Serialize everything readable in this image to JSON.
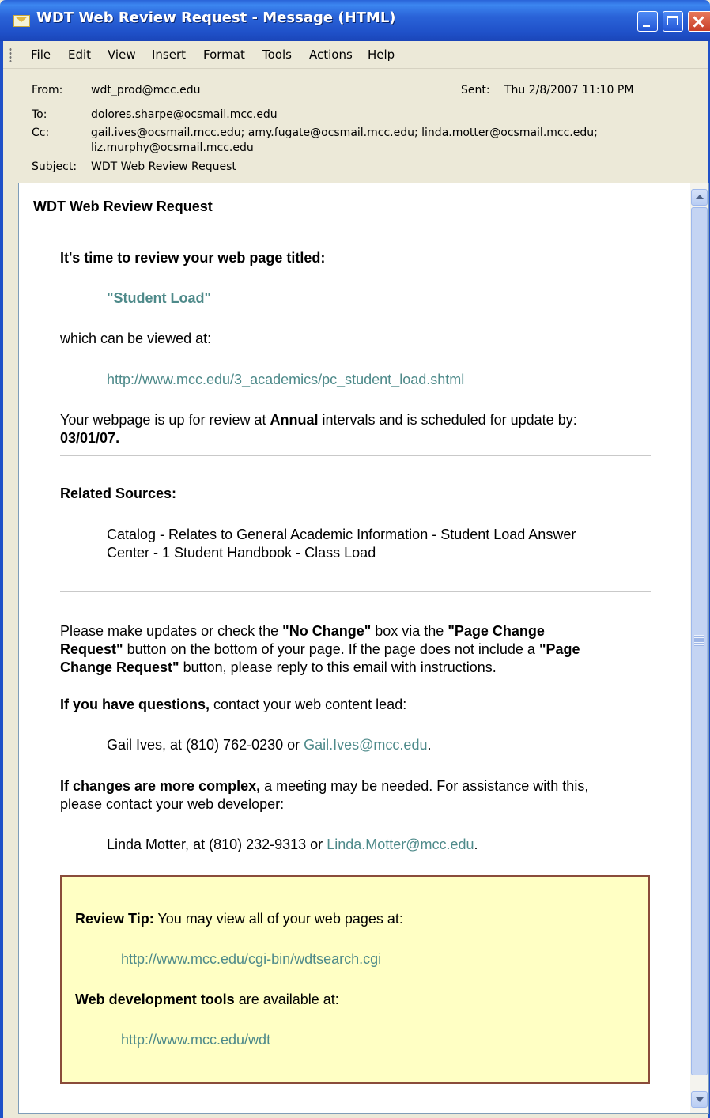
{
  "window": {
    "title": "WDT Web Review Request - Message (HTML)"
  },
  "menu": [
    "File",
    "Edit",
    "View",
    "Insert",
    "Format",
    "Tools",
    "Actions",
    "Help"
  ],
  "header": {
    "from_label": "From:",
    "from_value": "wdt_prod@mcc.edu",
    "sent_label": "Sent:",
    "sent_value": "Thu 2/8/2007 11:10 PM",
    "to_label": "To:",
    "to_value": "dolores.sharpe@ocsmail.mcc.edu",
    "cc_label": "Cc:",
    "cc_line1": "gail.ives@ocsmail.mcc.edu; amy.fugate@ocsmail.mcc.edu; linda.motter@ocsmail.mcc.edu;",
    "cc_line2": "liz.murphy@ocsmail.mcc.edu",
    "subject_label": "Subject:",
    "subject_value": "WDT Web Review Request"
  },
  "message": {
    "heading": "WDT Web Review Request",
    "intro": "It's time to review your web page titled:",
    "page_title": "\"Student Load\"",
    "viewed_at": "which can be viewed at:",
    "page_url": "http://www.mcc.edu/3_academics/pc_student_load.shtml",
    "review_pre": "Your webpage is up for review at ",
    "review_interval": "Annual",
    "review_post": " intervals and is scheduled for update by:",
    "review_date": "03/01/07.",
    "related_heading": "Related Sources:",
    "related_line1": "Catalog - Relates to General Academic Information - Student Load Answer",
    "related_line2": "Center - 1 Student Handbook - Class Load",
    "p1_a": "Please make updates or check the ",
    "p1_b": "\"No Change\"",
    "p1_c": " box via the ",
    "p1_d": "\"Page Change",
    "p2_a": "Request\"",
    "p2_b": " button on the bottom of your page. If the page does not include a ",
    "p2_c": "\"Page",
    "p3_a": "Change Request\"",
    "p3_b": " button, please reply to this email with instructions.",
    "questions_bold": "If you have questions,",
    "questions_rest": " contact your web content lead:",
    "lead_text": "Gail Ives, at (810) 762-0230 or ",
    "lead_email": "Gail.Ives@mcc.edu",
    "lead_end": ".",
    "complex_bold": "If changes are more complex,",
    "complex_rest": " a meeting may be needed. For assistance with this,",
    "complex_line2": "please contact your web developer:",
    "dev_text": "Linda Motter, at (810) 232-9313 or ",
    "dev_email": "Linda.Motter@mcc.edu",
    "dev_end": "."
  },
  "tip": {
    "label": "Review Tip:",
    "text": " You may view all of your web pages at:",
    "url1": "http://www.mcc.edu/cgi-bin/wdtsearch.cgi",
    "tools_bold": "Web development tools",
    "tools_rest": " are available at:",
    "url2": "http://www.mcc.edu/wdt"
  }
}
